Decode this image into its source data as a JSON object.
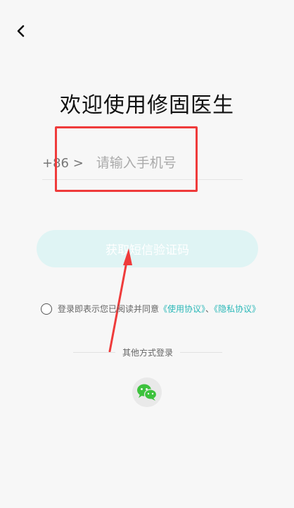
{
  "header": {
    "back_icon": "chevron-left-icon"
  },
  "title": "欢迎使用修固医生",
  "phone": {
    "country_code": "+86 >",
    "placeholder": "请输入手机号",
    "value": ""
  },
  "get_code_button": {
    "label": "获取短信验证码"
  },
  "agreement": {
    "prefix": "登录即表示您已阅读并同意",
    "terms_link": "《使用协议》",
    "separator": "、",
    "privacy_link": "《隐私协议》",
    "checked": false
  },
  "other_login": {
    "label": "其他方式登录",
    "wechat_icon": "wechat-icon"
  },
  "colors": {
    "accent": "#2bb8b8",
    "button_disabled": "#dff4f4",
    "annotation_red": "#ef3b3b"
  }
}
